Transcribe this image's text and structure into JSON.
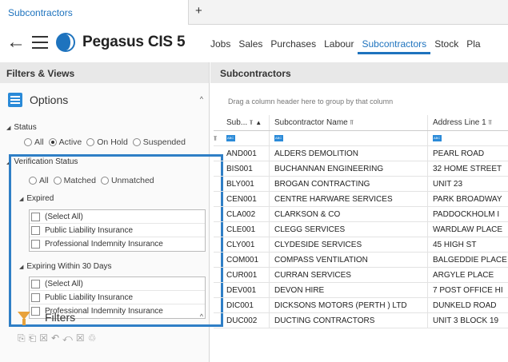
{
  "tab": {
    "title": "Subcontractors",
    "new_tab": "+"
  },
  "header": {
    "app_title": "Pegasus CIS 5",
    "nav": [
      "Jobs",
      "Sales",
      "Purchases",
      "Labour",
      "Subcontractors",
      "Stock",
      "Pla"
    ],
    "active_nav": "Subcontractors"
  },
  "left": {
    "title": "Filters & Views",
    "options_label": "Options",
    "status": {
      "label": "Status",
      "options": [
        "All",
        "Active",
        "On Hold",
        "Suspended"
      ],
      "selected": "Active"
    },
    "verification": {
      "label": "Verification Status",
      "options": [
        "All",
        "Matched",
        "Unmatched"
      ]
    },
    "expired": {
      "label": "Expired",
      "items": [
        "(Select All)",
        "Public Liability Insurance",
        "Professional Indemnity Insurance"
      ]
    },
    "expiring": {
      "label": "Expiring Within 30 Days",
      "items": [
        "(Select All)",
        "Public Liability Insurance",
        "Professional Indemnity Insurance"
      ]
    },
    "filters_label": "Filters"
  },
  "grid": {
    "title": "Subcontractors",
    "group_hint": "Drag a column header here to group by that column",
    "columns": [
      "Sub...",
      "Subcontractor Name",
      "Address Line 1"
    ],
    "rows": [
      [
        "AND001",
        "ALDERS DEMOLITION",
        "PEARL ROAD"
      ],
      [
        "BIS001",
        "BUCHANNAN ENGINEERING",
        "32 HOME STREET"
      ],
      [
        "BLY001",
        "BROGAN CONTRACTING",
        "UNIT 23"
      ],
      [
        "CEN001",
        "CENTRE HARWARE SERVICES",
        "PARK BROADWAY"
      ],
      [
        "CLA002",
        "CLARKSON & CO",
        "PADDOCKHOLM I"
      ],
      [
        "CLE001",
        "CLEGG SERVICES",
        "WARDLAW PLACE"
      ],
      [
        "CLY001",
        "CLYDESIDE SERVICES",
        "45 HIGH ST"
      ],
      [
        "COM001",
        "COMPASS VENTILATION",
        "BALGEDDIE PLACE"
      ],
      [
        "CUR001",
        "CURRAN SERVICES",
        "ARGYLE PLACE"
      ],
      [
        "DEV001",
        "DEVON HIRE",
        "7 POST OFFICE HI"
      ],
      [
        "DIC001",
        "DICKSONS MOTORS (PERTH ) LTD",
        "DUNKELD ROAD"
      ],
      [
        "DUC002",
        "DUCTING CONTRACTORS",
        "UNIT 3 BLOCK 19"
      ]
    ]
  },
  "colors": {
    "accent": "#1e73be",
    "highlight": "#2f7fc6",
    "filter_icon": "#e8a23b"
  }
}
